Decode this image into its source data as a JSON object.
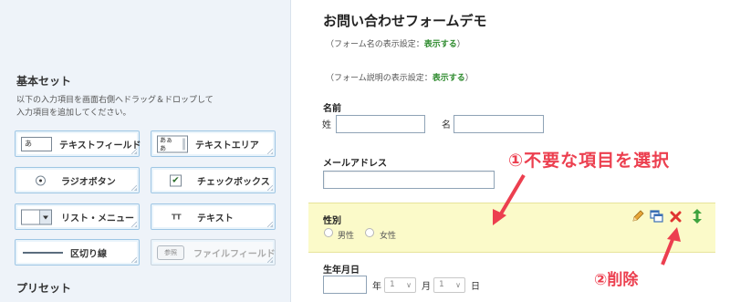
{
  "left_panel": {
    "basic_set_title": "基本セット",
    "instructions_line1": "以下の入力項目を画面右側へドラッグ＆ドロップして",
    "instructions_line2": "入力項目を追加してください。",
    "palette": {
      "text_field": {
        "label": "テキストフィールド",
        "icon_text": "あ"
      },
      "text_area": {
        "label": "テキストエリア",
        "icon_text": "あぁ\nあ"
      },
      "radio_button": {
        "label": "ラジオボタン"
      },
      "checkbox": {
        "label": "チェックボックス",
        "icon_text": "✔"
      },
      "list_menu": {
        "label": "リスト・メニュー"
      },
      "text": {
        "label": "テキスト",
        "icon_text": "TT"
      },
      "separator": {
        "label": "区切り線"
      },
      "file_field": {
        "label": "ファイルフィールド",
        "icon_text": "参照"
      }
    },
    "preset_title": "プリセット"
  },
  "form": {
    "title": "お問い合わせフォームデモ",
    "name_setting": {
      "prefix": "（フォーム名の表示設定：",
      "link": "表示する",
      "suffix": "）"
    },
    "description_setting": {
      "prefix": "（フォーム説明の表示設定：",
      "link": "表示する",
      "suffix": "）"
    },
    "name_field": {
      "label": "名前",
      "last_name_label": "姓",
      "first_name_label": "名"
    },
    "email_field": {
      "label": "メールアドレス"
    },
    "gender_field": {
      "label": "性別",
      "options": [
        "男性",
        "女性"
      ]
    },
    "birthday_field": {
      "label": "生年月日",
      "year_unit": "年",
      "month_value": "1",
      "month_unit": "月",
      "day_value": "1",
      "day_unit": "日"
    },
    "row_tools": [
      "pencil-icon",
      "copy-icon",
      "delete-icon",
      "move-icon"
    ]
  },
  "annotations": {
    "step1": "①不要な項目を選択",
    "step2": "②削除"
  },
  "colors": {
    "accent_red": "#ec3f4f",
    "link_green": "#2e8b2e",
    "highlight_yellow": "#fbfac9",
    "panel_bg": "#eef3f9"
  }
}
